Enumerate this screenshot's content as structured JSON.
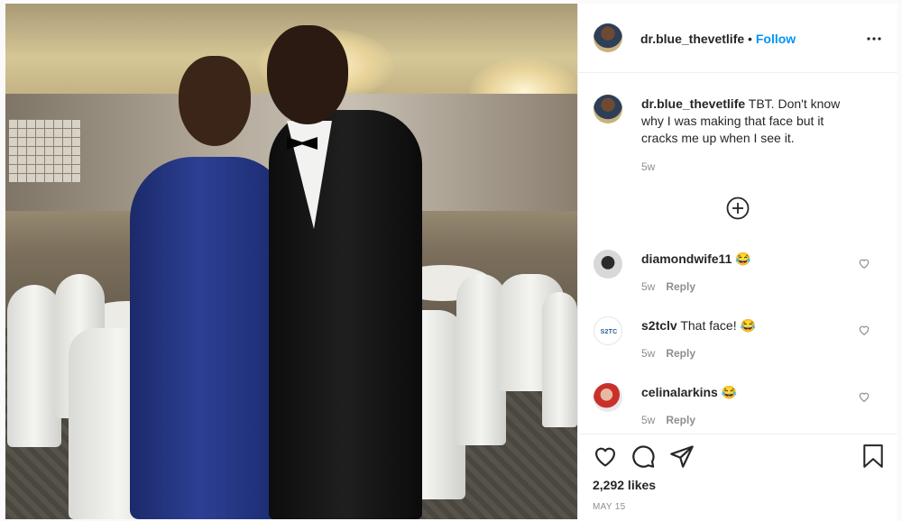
{
  "post": {
    "username": "dr.blue_thevetlife",
    "dot": "•",
    "follow_label": "Follow",
    "more_icon": "more-options-icon"
  },
  "caption": {
    "username": "dr.blue_thevetlife",
    "text_line1": "TBT. Don't know",
    "text_line2": "why I was making that face but it",
    "text_line3": "cracks me up when I see it.",
    "time": "5w"
  },
  "load_more_icon": "plus-circle-icon",
  "comments": [
    {
      "username": "diamondwife11",
      "text": "😂",
      "time": "5w",
      "reply_label": "Reply"
    },
    {
      "username": "s2tclv",
      "text": "That face! 😂",
      "time": "5w",
      "reply_label": "Reply"
    },
    {
      "username": "celinalarkins",
      "text": "😂",
      "time": "5w",
      "reply_label": "Reply"
    }
  ],
  "s2tc_avatar_text": "S2TC",
  "actions": {
    "like_icon": "heart-icon",
    "comment_icon": "comment-icon",
    "share_icon": "share-icon",
    "save_icon": "bookmark-icon"
  },
  "likes": "2,292 likes",
  "date": "MAY 15",
  "colors": {
    "link": "#0095f6",
    "muted": "#8e8e8e",
    "text": "#262626"
  }
}
